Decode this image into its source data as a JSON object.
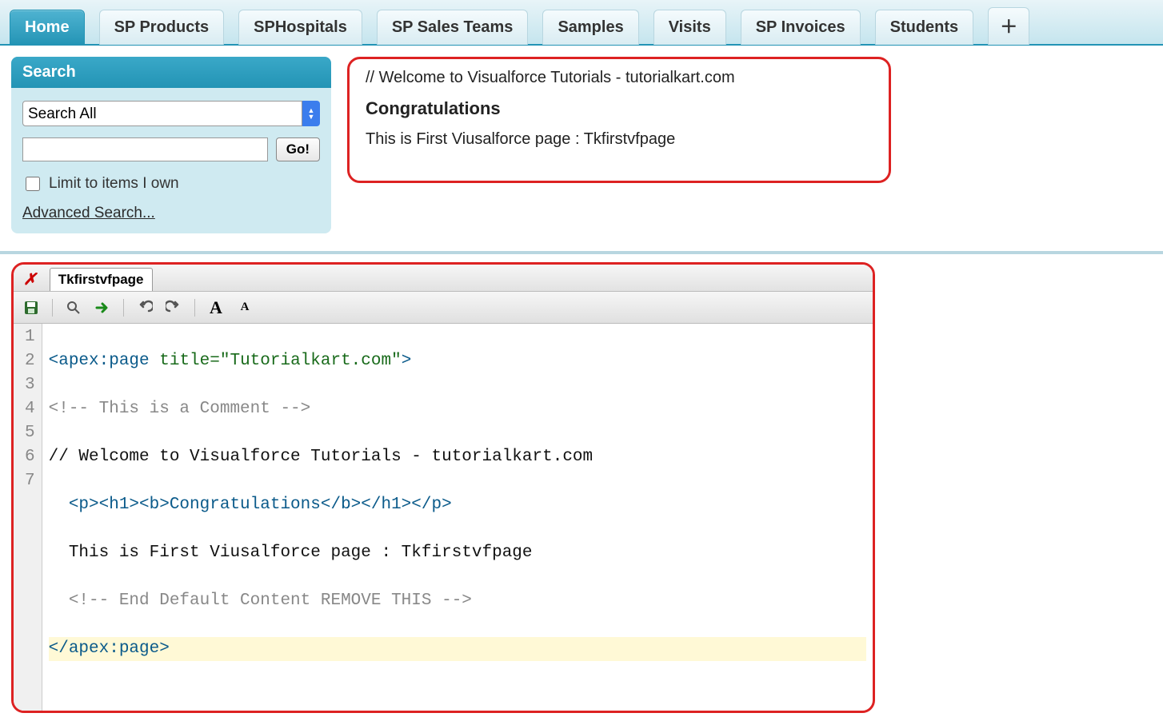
{
  "tabs": {
    "items": [
      {
        "label": "Home",
        "active": true
      },
      {
        "label": "SP Products",
        "active": false
      },
      {
        "label": "SPHospitals",
        "active": false
      },
      {
        "label": "SP Sales Teams",
        "active": false
      },
      {
        "label": "Samples",
        "active": false
      },
      {
        "label": "Visits",
        "active": false
      },
      {
        "label": "SP Invoices",
        "active": false
      },
      {
        "label": "Students",
        "active": false
      }
    ],
    "add_glyph": "＋"
  },
  "search": {
    "title": "Search",
    "select_value": "Search All",
    "input_value": "",
    "go_label": "Go!",
    "limit_label": "Limit to items I own",
    "advanced_label": "Advanced Search..."
  },
  "output": {
    "line1": "// Welcome to Visualforce Tutorials - tutorialkart.com",
    "heading": "Congratulations",
    "line3": "This is First Viusalforce page : Tkfirstvfpage"
  },
  "editor": {
    "tab_label": "Tkfirstvfpage",
    "line_numbers": [
      "1",
      "2",
      "3",
      "4",
      "5",
      "6",
      "7"
    ],
    "code": {
      "l1_pre": "<apex:page ",
      "l1_attr": "title=",
      "l1_str": "\"Tutorialkart.com\"",
      "l1_post": ">",
      "l2": "<!-- This is a Comment -->",
      "l3": "// Welcome to Visualforce Tutorials - tutorialkart.com",
      "l4": "  <p><h1><b>Congratulations</b></h1></p>",
      "l5": "  This is First Viusalforce page : Tkfirstvfpage",
      "l6": "  <!-- End Default Content REMOVE THIS -->",
      "l7": "</apex:page>"
    }
  }
}
